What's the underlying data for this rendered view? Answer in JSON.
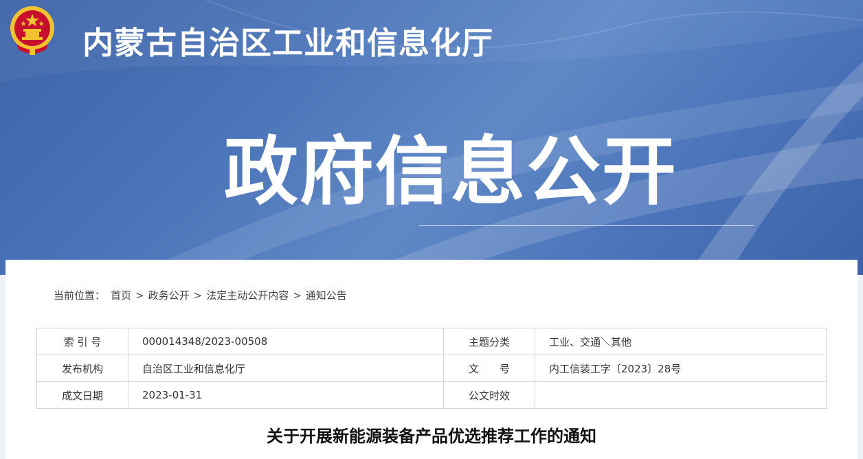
{
  "header": {
    "site_name": "内蒙古自治区工业和信息化厅",
    "banner_title": "政府信息公开"
  },
  "colors": {
    "header_blue": "#4a73b8",
    "emblem_red": "#c8102e",
    "emblem_gold": "#f2c230"
  },
  "breadcrumb": {
    "prefix": "当前位置：",
    "items": [
      "首页",
      "政务公开",
      "法定主动公开内容",
      "通知公告"
    ],
    "separator": ">"
  },
  "meta_table": {
    "rows": [
      {
        "label1": "索 引 号",
        "value1": "000014348/2023-00508",
        "label2": "主题分类",
        "value2": "工业、交通＼其他"
      },
      {
        "label1": "发布机构",
        "value1": "自治区工业和信息化厅",
        "label2": "文　　号",
        "value2": "内工信装工字〔2023〕28号"
      },
      {
        "label1": "成文日期",
        "value1": "2023-01-31",
        "label2": "公文时效",
        "value2": ""
      }
    ]
  },
  "document": {
    "title": "关于开展新能源装备产品优选推荐工作的通知"
  }
}
